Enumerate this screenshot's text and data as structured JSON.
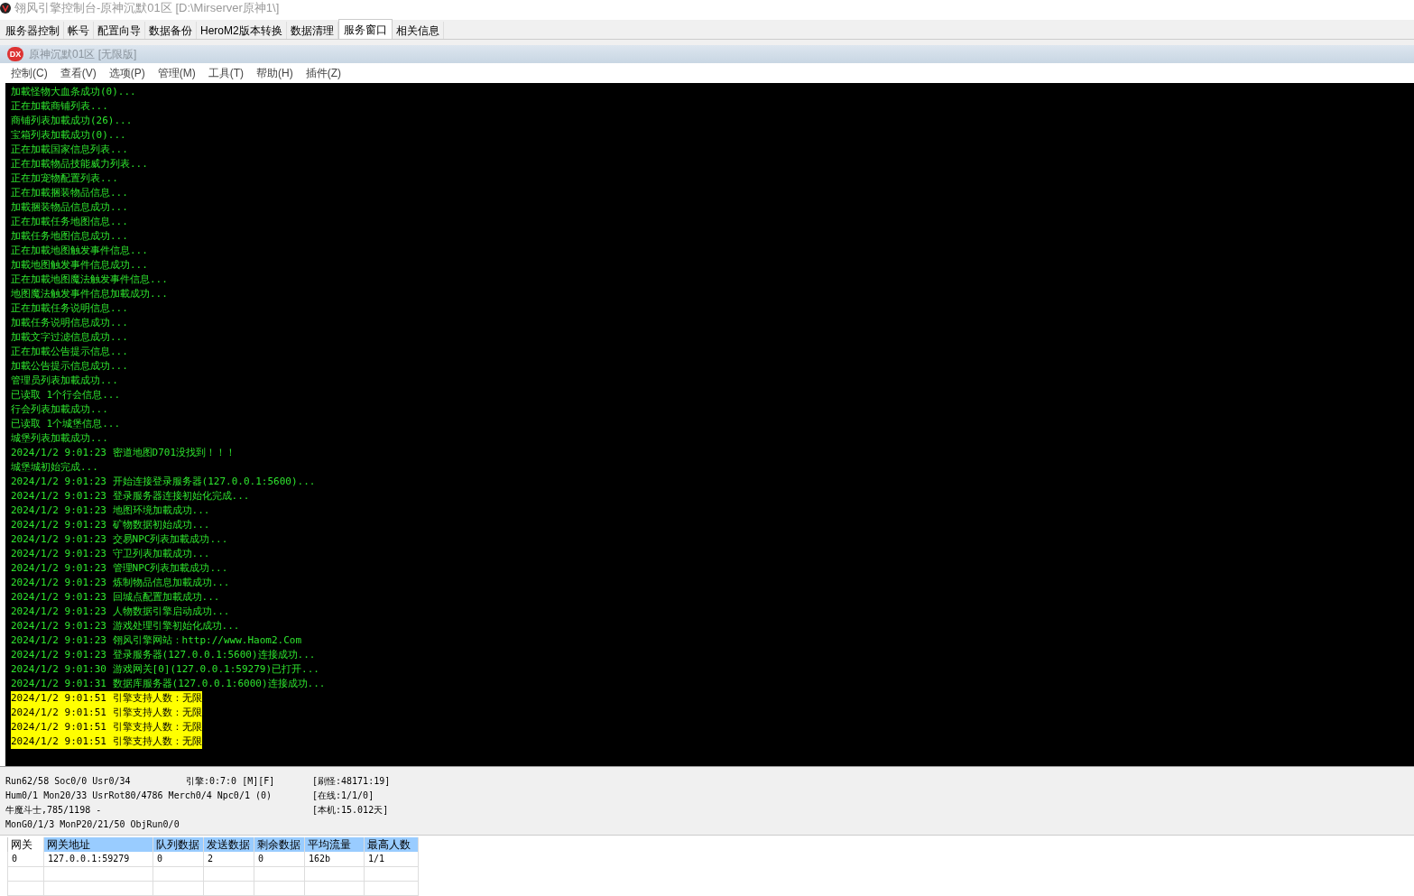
{
  "window": {
    "title": "翎风引擎控制台-原神沉默01区 [D:\\Mirserver原神1\\]"
  },
  "tabs": [
    {
      "label": "服务器控制",
      "selected": false
    },
    {
      "label": "帐号",
      "selected": false
    },
    {
      "label": "配置向导",
      "selected": false
    },
    {
      "label": "数据备份",
      "selected": false
    },
    {
      "label": "HeroM2版本转换",
      "selected": false
    },
    {
      "label": "数据清理",
      "selected": false
    },
    {
      "label": "服务窗口",
      "selected": true
    },
    {
      "label": "相关信息",
      "selected": false
    }
  ],
  "inner_window": {
    "title": "原神沉默01区 [无限版]",
    "icon_text": "DX"
  },
  "menu": [
    "控制(C)",
    "查看(V)",
    "选项(P)",
    "管理(M)",
    "工具(T)",
    "帮助(H)",
    "插件(Z)"
  ],
  "log": [
    {
      "text": "加載怪物大血条成功(0)...",
      "highlighted": false
    },
    {
      "text": "正在加載商铺列表...",
      "highlighted": false
    },
    {
      "text": "商铺列表加載成功(26)...",
      "highlighted": false
    },
    {
      "text": "宝箱列表加載成功(0)...",
      "highlighted": false
    },
    {
      "text": "正在加載国家信息列表...",
      "highlighted": false
    },
    {
      "text": "正在加載物品技能威力列表...",
      "highlighted": false
    },
    {
      "text": "正在加宠物配置列表...",
      "highlighted": false
    },
    {
      "text": "正在加載捆装物品信息...",
      "highlighted": false
    },
    {
      "text": "加載捆装物品信息成功...",
      "highlighted": false
    },
    {
      "text": "正在加載任务地图信息...",
      "highlighted": false
    },
    {
      "text": "加載任务地图信息成功...",
      "highlighted": false
    },
    {
      "text": "正在加載地图触发事件信息...",
      "highlighted": false
    },
    {
      "text": "加載地图触发事件信息成功...",
      "highlighted": false
    },
    {
      "text": "正在加載地图魔法触发事件信息...",
      "highlighted": false
    },
    {
      "text": "地图魔法触发事件信息加載成功...",
      "highlighted": false
    },
    {
      "text": "正在加載任务说明信息...",
      "highlighted": false
    },
    {
      "text": "加載任务说明信息成功...",
      "highlighted": false
    },
    {
      "text": "加載文字过滤信息成功...",
      "highlighted": false
    },
    {
      "text": "正在加載公告提示信息...",
      "highlighted": false
    },
    {
      "text": "加載公告提示信息成功...",
      "highlighted": false
    },
    {
      "text": "管理员列表加載成功...",
      "highlighted": false
    },
    {
      "text": "已读取 1个行会信息...",
      "highlighted": false
    },
    {
      "text": "行会列表加載成功...",
      "highlighted": false
    },
    {
      "text": "已读取 1个城堡信息...",
      "highlighted": false
    },
    {
      "text": "城堡列表加載成功...",
      "highlighted": false
    },
    {
      "text": "2024/1/2 9:01:23 密道地图D701没找到！！！",
      "highlighted": false
    },
    {
      "text": "城堡城初始完成...",
      "highlighted": false
    },
    {
      "text": "2024/1/2 9:01:23 开始连接登录服务器(127.0.0.1:5600)...",
      "highlighted": false
    },
    {
      "text": "2024/1/2 9:01:23 登录服务器连接初始化完成...",
      "highlighted": false
    },
    {
      "text": "2024/1/2 9:01:23 地图环境加載成功...",
      "highlighted": false
    },
    {
      "text": "2024/1/2 9:01:23 矿物数据初始成功...",
      "highlighted": false
    },
    {
      "text": "2024/1/2 9:01:23 交易NPC列表加載成功...",
      "highlighted": false
    },
    {
      "text": "2024/1/2 9:01:23 守卫列表加載成功...",
      "highlighted": false
    },
    {
      "text": "2024/1/2 9:01:23 管理NPC列表加載成功...",
      "highlighted": false
    },
    {
      "text": "2024/1/2 9:01:23 炼制物品信息加載成功...",
      "highlighted": false
    },
    {
      "text": "2024/1/2 9:01:23 回城点配置加載成功...",
      "highlighted": false
    },
    {
      "text": "2024/1/2 9:01:23 人物数据引擎启动成功...",
      "highlighted": false
    },
    {
      "text": "2024/1/2 9:01:23 游戏处理引擎初始化成功...",
      "highlighted": false
    },
    {
      "text": "2024/1/2 9:01:23 翎风引擎网站：http://www.Haom2.Com",
      "highlighted": false
    },
    {
      "text": "2024/1/2 9:01:23 登录服务器(127.0.0.1:5600)连接成功...",
      "highlighted": false
    },
    {
      "text": "2024/1/2 9:01:30 游戏网关[0](127.0.0.1:59279)已打开...",
      "highlighted": false
    },
    {
      "text": "2024/1/2 9:01:31 数据库服务器(127.0.0.1:6000)连接成功...",
      "highlighted": false
    },
    {
      "text": "2024/1/2 9:01:51 引擎支持人数：无限",
      "highlighted": true
    },
    {
      "text": "2024/1/2 9:01:51 引擎支持人数：无限",
      "highlighted": true
    },
    {
      "text": "2024/1/2 9:01:51 引擎支持人数：无限",
      "highlighted": true
    },
    {
      "text": "2024/1/2 9:01:51 引擎支持人数：无限",
      "highlighted": true
    }
  ],
  "status": [
    {
      "left": "Run62/58 Soc0/0 Usr0/34",
      "middle": "引擎:0:7:0 [M][F]",
      "right": "[刷怪:48171:19]"
    },
    {
      "left": "Hum0/1 Mon20/33 UsrRot80/4786 Merch0/4 Npc0/1 (0)",
      "right": "[在线:1/1/0]"
    },
    {
      "left": "牛魔斗士,785/1198 -",
      "right": "[本机:15.012天]"
    },
    {
      "left": "MonG0/1/3 MonP20/21/50 ObjRun0/0"
    }
  ],
  "table": {
    "columns": [
      {
        "label": "网关",
        "highlighted": false
      },
      {
        "label": "网关地址",
        "highlighted": true
      },
      {
        "label": "队列数据",
        "highlighted": true
      },
      {
        "label": "发送数据",
        "highlighted": true
      },
      {
        "label": "剩余数据",
        "highlighted": true
      },
      {
        "label": "平均流量",
        "highlighted": true
      },
      {
        "label": "最高人数",
        "highlighted": true
      }
    ],
    "rows": [
      [
        "0",
        "127.0.0.1:59279",
        "0",
        "2",
        "0",
        "162b",
        "1/1"
      ]
    ]
  }
}
